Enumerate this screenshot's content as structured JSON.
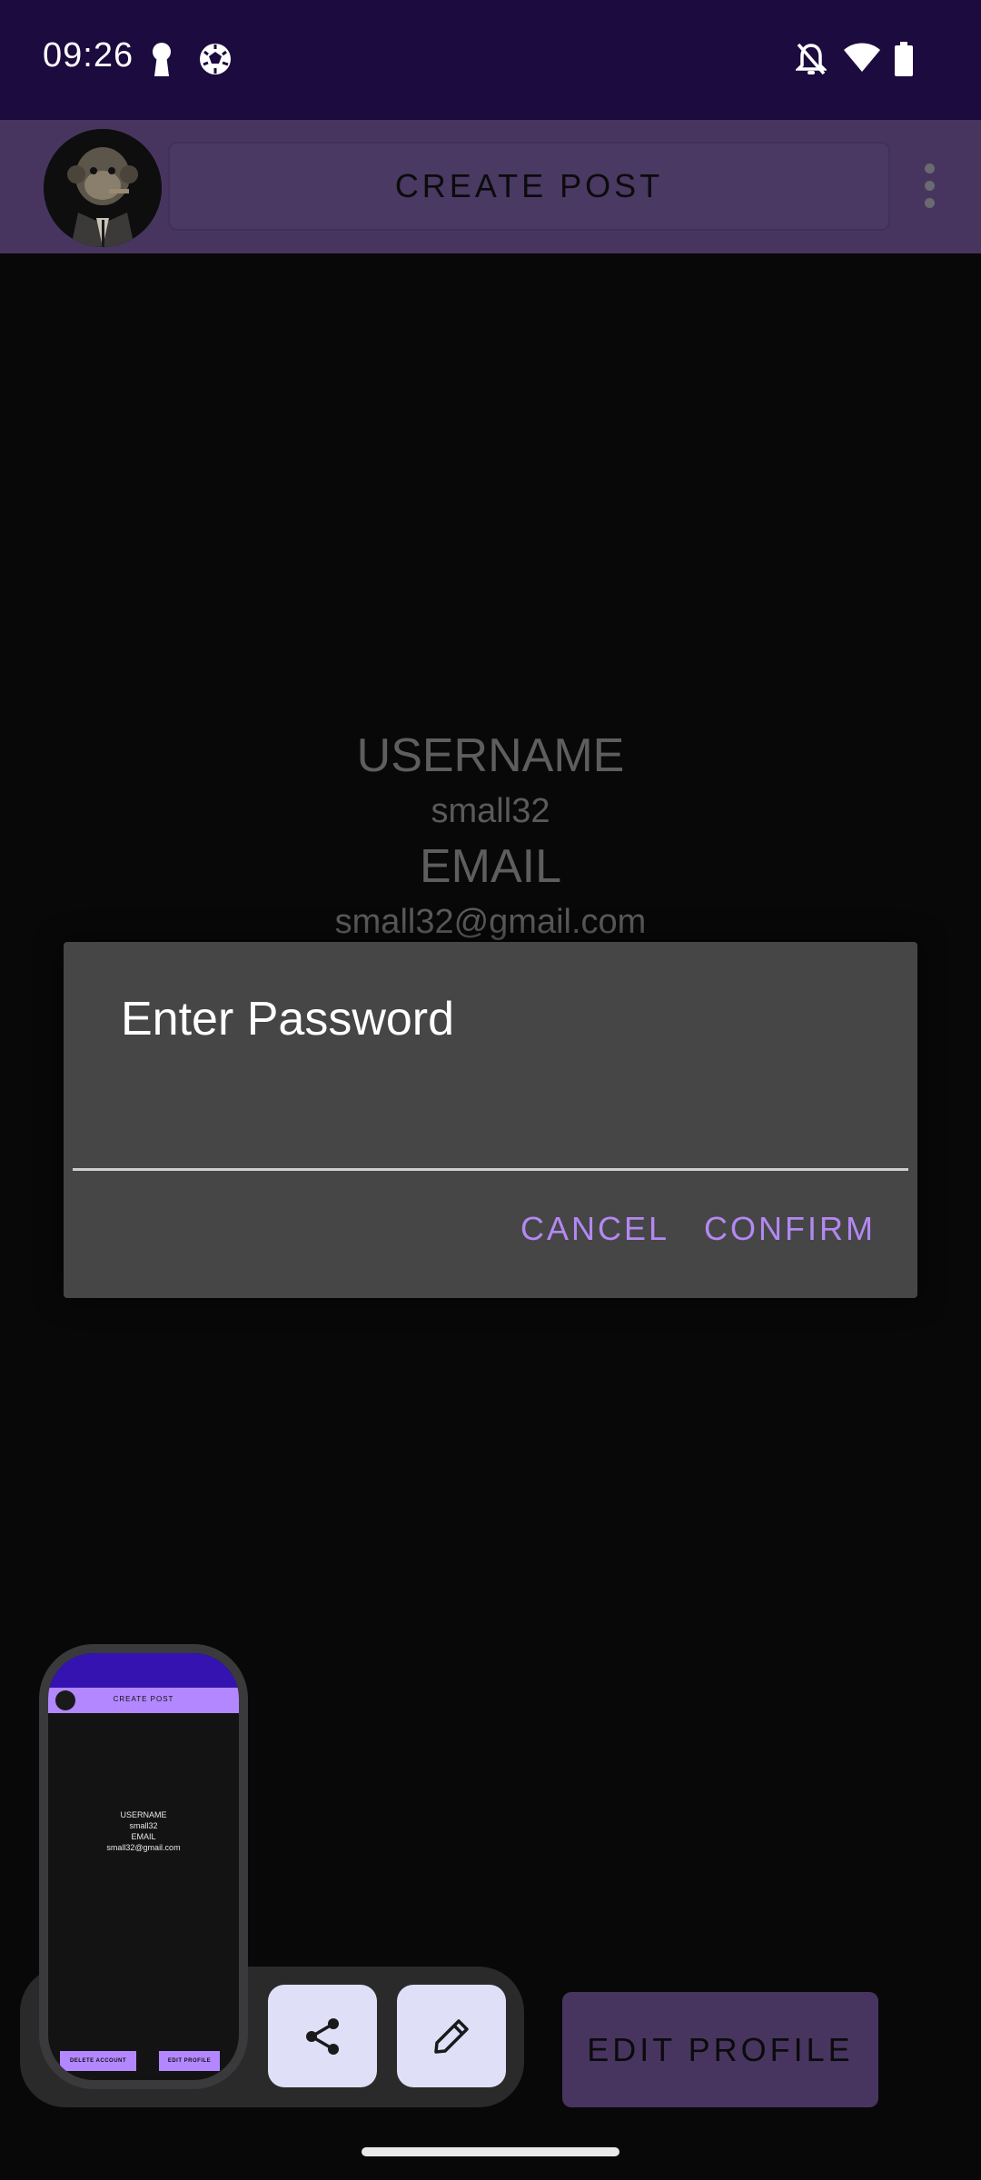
{
  "status_bar": {
    "time": "09:26",
    "icons": [
      "keyhole-icon",
      "soccer-ball-icon",
      "bell-off-icon",
      "wifi-icon",
      "battery-icon"
    ]
  },
  "app_bar": {
    "create_post_label": "CREATE POST",
    "avatar": "monkey-avatar-icon",
    "overflow": "overflow-menu-icon"
  },
  "profile": {
    "username_label": "USERNAME",
    "username_value": "small32",
    "email_label": "EMAIL",
    "email_value": "small32@gmail.com"
  },
  "dialog": {
    "title": "Enter Password",
    "input_value": "",
    "cancel_label": "CANCEL",
    "confirm_label": "CONFIRM"
  },
  "screenshot_preview": {
    "create_post_label": "CREATE POST",
    "username_label": "USERNAME",
    "username_value": "small32",
    "email_label": "EMAIL",
    "email_value": "small32@gmail.com",
    "delete_account_label": "DELETE ACCOUNT",
    "edit_profile_label": "EDIT PROFILE"
  },
  "actions": {
    "share": "share-icon",
    "edit": "pencil-icon"
  },
  "bottom": {
    "edit_profile_label": "EDIT PROFILE"
  },
  "colors": {
    "status_bar": "#1b0b3e",
    "app_bar": "#473560",
    "accent": "#b388f2",
    "dialog": "#464646"
  }
}
